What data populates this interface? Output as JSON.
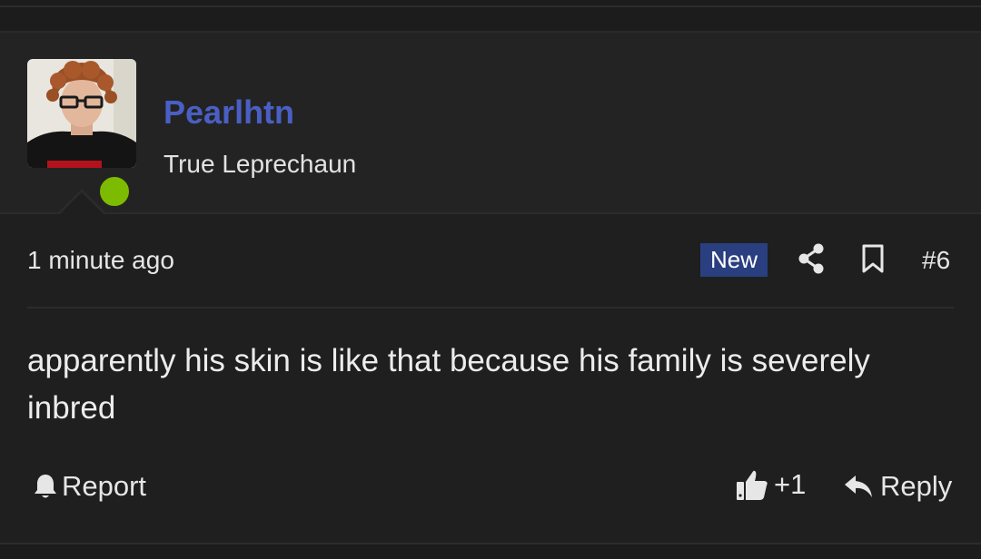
{
  "user": {
    "username": "Pearlhtn",
    "title": "True Leprechaun",
    "online": true,
    "username_color": "#4a5fc4",
    "online_color": "#7cbb00"
  },
  "post": {
    "time": "1 minute ago",
    "badge": "New",
    "badge_color": "#2a3f80",
    "number": "#6",
    "body": "apparently his skin is like that because his family is severely inbred"
  },
  "actions": {
    "report_label": "Report",
    "report_icon": "bell-icon",
    "like_count": "+1",
    "like_icon": "thumbs-up-icon",
    "reply_label": "Reply",
    "reply_icon": "reply-arrow-icon",
    "share_icon": "share-icon",
    "bookmark_icon": "bookmark-icon"
  }
}
